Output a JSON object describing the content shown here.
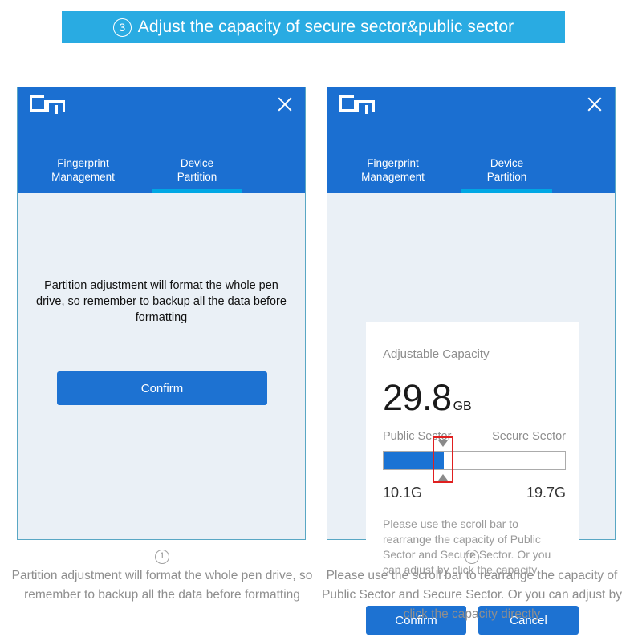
{
  "banner": {
    "number": "3",
    "title": "Adjust  the capacity of secure sector&public sector",
    "bg_color": "#29ABE2"
  },
  "colors": {
    "header_blue": "#1B6FD1",
    "accent_cyan": "#00A7E4",
    "button_blue": "#1D72D2",
    "panel_bg": "#EAF0F6",
    "panel_border": "#59A7C4",
    "slider_fill": "#1A73D4",
    "highlight_red": "#E02020"
  },
  "left_panel": {
    "logo": "DM",
    "close_icon": "close-icon",
    "tabs": [
      {
        "label": "Fingerprint\nManagement",
        "line1": "Fingerprint",
        "line2": "Management",
        "active": false
      },
      {
        "label": "Device\nPartition",
        "line1": "Device",
        "line2": "Partition",
        "active": true
      }
    ],
    "warning_text": "Partition adjustment will format the whole pen drive, so remember to backup all the data before formatting",
    "confirm_label": "Confirm"
  },
  "right_panel": {
    "logo": "DM",
    "close_icon": "close-icon",
    "tabs": [
      {
        "line1": "Fingerprint",
        "line2": "Management",
        "active": false
      },
      {
        "line1": "Device",
        "line2": "Partition",
        "active": true
      }
    ],
    "card": {
      "heading": "Adjustable Capacity",
      "total_value": "29.8",
      "total_unit": "GB",
      "public_label": "Public  Sector",
      "secure_label": "Secure  Sector",
      "public_size": "10.1G",
      "secure_size": "19.7G",
      "slider_fill_percent": 33,
      "arrow_down_icon": "triangle-down-icon",
      "arrow_up_icon": "triangle-up-icon",
      "help_text": "Please use the scroll bar to rearrange the capacity of Public Sector and Secure Sector. Or you can adjust  by click the capacity"
    },
    "confirm_label": "Confirm",
    "cancel_label": "Cancel"
  },
  "captions": {
    "left": {
      "number": "1",
      "text": "Partition adjustment will format the whole pen drive, so remember to backup all the data before formatting"
    },
    "right": {
      "number": "2",
      "text": "Please use the scroll bar to rearrange the capacity of Public Sector and Secure Sector. Or you can adjust  by click the capacity directly"
    }
  }
}
